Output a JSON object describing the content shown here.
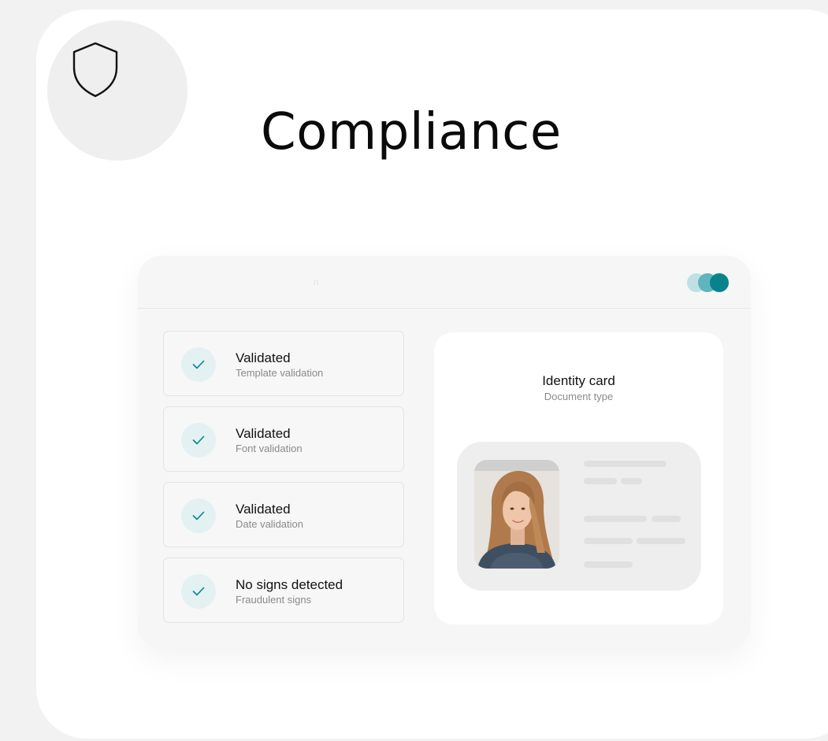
{
  "header": {
    "title": "Compliance",
    "icon": "shield-icon"
  },
  "window": {
    "header_glyph": "n",
    "dots_colors": [
      "#bfe1e4",
      "#5fb5bb",
      "#08838e"
    ]
  },
  "checks": [
    {
      "title": "Validated",
      "subtitle": "Template validation",
      "icon": "checkmark-icon"
    },
    {
      "title": "Validated",
      "subtitle": "Font validation",
      "icon": "checkmark-icon"
    },
    {
      "title": "Validated",
      "subtitle": "Date validation",
      "icon": "checkmark-icon"
    },
    {
      "title": "No signs detected",
      "subtitle": "Fraudulent signs",
      "icon": "checkmark-icon"
    }
  ],
  "document": {
    "title": "Identity card",
    "subtitle": "Document type"
  },
  "colors": {
    "accent": "#08838e",
    "check_bg": "#e4f1f3",
    "text": "#111111",
    "muted": "#8a8a8a"
  }
}
